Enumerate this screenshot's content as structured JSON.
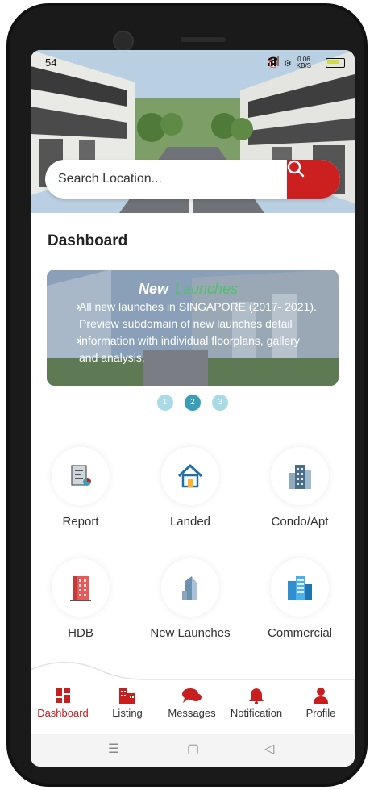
{
  "status": {
    "time": "54",
    "speed_value": "0.06",
    "speed_unit": "KB/S"
  },
  "search": {
    "placeholder": "Search Location..."
  },
  "dashboard": {
    "title": "Dashboard"
  },
  "banner": {
    "new_text": "New",
    "launches_text": "Launches",
    "line1": "All new launches in SINGAPORE (2017- 2021).",
    "line2": "Preview subdomain of new launches detail",
    "line3": "information with individual floorplans, gallery",
    "line4": "and analysis."
  },
  "pagination": {
    "pages": [
      "1",
      "2",
      "3"
    ],
    "active_page": "2"
  },
  "categories": [
    {
      "label": "Report",
      "icon": "report-icon"
    },
    {
      "label": "Landed",
      "icon": "house-icon"
    },
    {
      "label": "Condo/Apt",
      "icon": "condo-building-icon"
    },
    {
      "label": "HDB",
      "icon": "hdb-building-icon"
    },
    {
      "label": "New Launches",
      "icon": "new-launch-tower-icon"
    },
    {
      "label": "Commercial",
      "icon": "commercial-building-icon"
    }
  ],
  "nav": {
    "items": [
      {
        "label": "Dashboard",
        "icon": "dashboard-icon",
        "active": true
      },
      {
        "label": "Listing",
        "icon": "listing-icon",
        "active": false
      },
      {
        "label": "Messages",
        "icon": "messages-icon",
        "active": false
      },
      {
        "label": "Notification",
        "icon": "bell-icon",
        "active": false
      },
      {
        "label": "Profile",
        "icon": "profile-icon",
        "active": false
      }
    ]
  },
  "system_nav": {
    "icons": [
      "menu-icon",
      "home-square-icon",
      "back-triangle-icon"
    ]
  },
  "colors": {
    "accent": "#cc1f1f",
    "dot_active": "#3a9eb8",
    "dot_inactive": "#a9dbe6",
    "launches_green": "#4fc06a"
  }
}
